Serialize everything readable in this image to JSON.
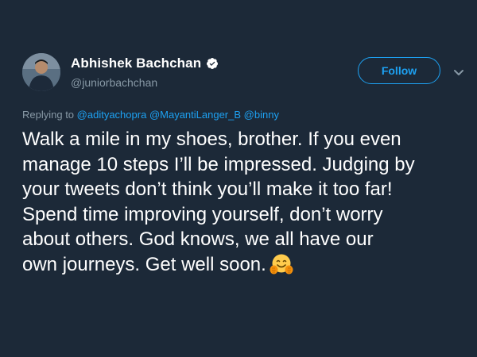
{
  "author": {
    "display_name": "Abhishek Bachchan",
    "handle": "@juniorbachchan",
    "verified": true
  },
  "actions": {
    "follow_label": "Follow",
    "menu_icon": "chevron-down-icon"
  },
  "reply_context": {
    "prefix": "Replying to",
    "mentions": [
      "@adityachopra",
      "@MayantiLanger_B",
      "@binny"
    ]
  },
  "tweet": {
    "lines": [
      "Walk a mile in my shoes, brother. If you even",
      "manage 10 steps I’ll be impressed. Judging by",
      "your tweets don’t think you’ll make it too far!",
      "Spend time improving yourself, don’t worry",
      "about others. God knows, we all have our",
      "own journeys. Get well soon."
    ],
    "emoji": "hugging-face-emoji"
  },
  "colors": {
    "background": "#1c2938",
    "accent": "#1da1f2",
    "text": "#ffffff",
    "muted": "#8899a6"
  }
}
